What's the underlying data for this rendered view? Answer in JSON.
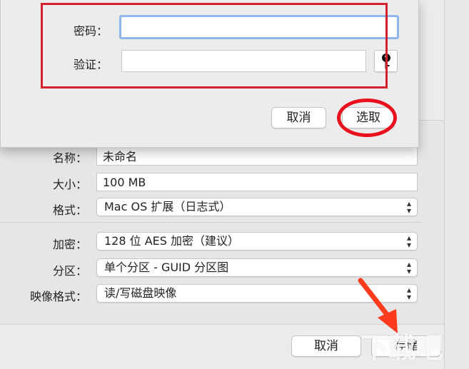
{
  "sheet": {
    "password_label": "密码：",
    "password_value": "",
    "verify_label": "验证：",
    "verify_value": "",
    "cancel_label": "取消",
    "choose_label": "选取"
  },
  "form": {
    "name_label": "名称：",
    "name_value": "未命名",
    "size_label": "大小：",
    "size_value": "100 MB",
    "format_label": "格式：",
    "format_value": "Mac OS 扩展（日志式）",
    "encryption_label": "加密：",
    "encryption_value": "128 位 AES 加密（建议）",
    "partition_label": "分区：",
    "partition_value": "单个分区 - GUID 分区图",
    "image_format_label": "映像格式：",
    "image_format_value": "读/写磁盘映像"
  },
  "footer": {
    "cancel_label": "取消",
    "save_label": "存储"
  },
  "icons": {
    "key": "key-icon",
    "chevron": "chevron-updown-icon"
  },
  "annotation_colors": {
    "highlight": "#d4202a",
    "arrow": "#ff3b1f"
  },
  "watermark": {
    "text": "下载吧"
  }
}
